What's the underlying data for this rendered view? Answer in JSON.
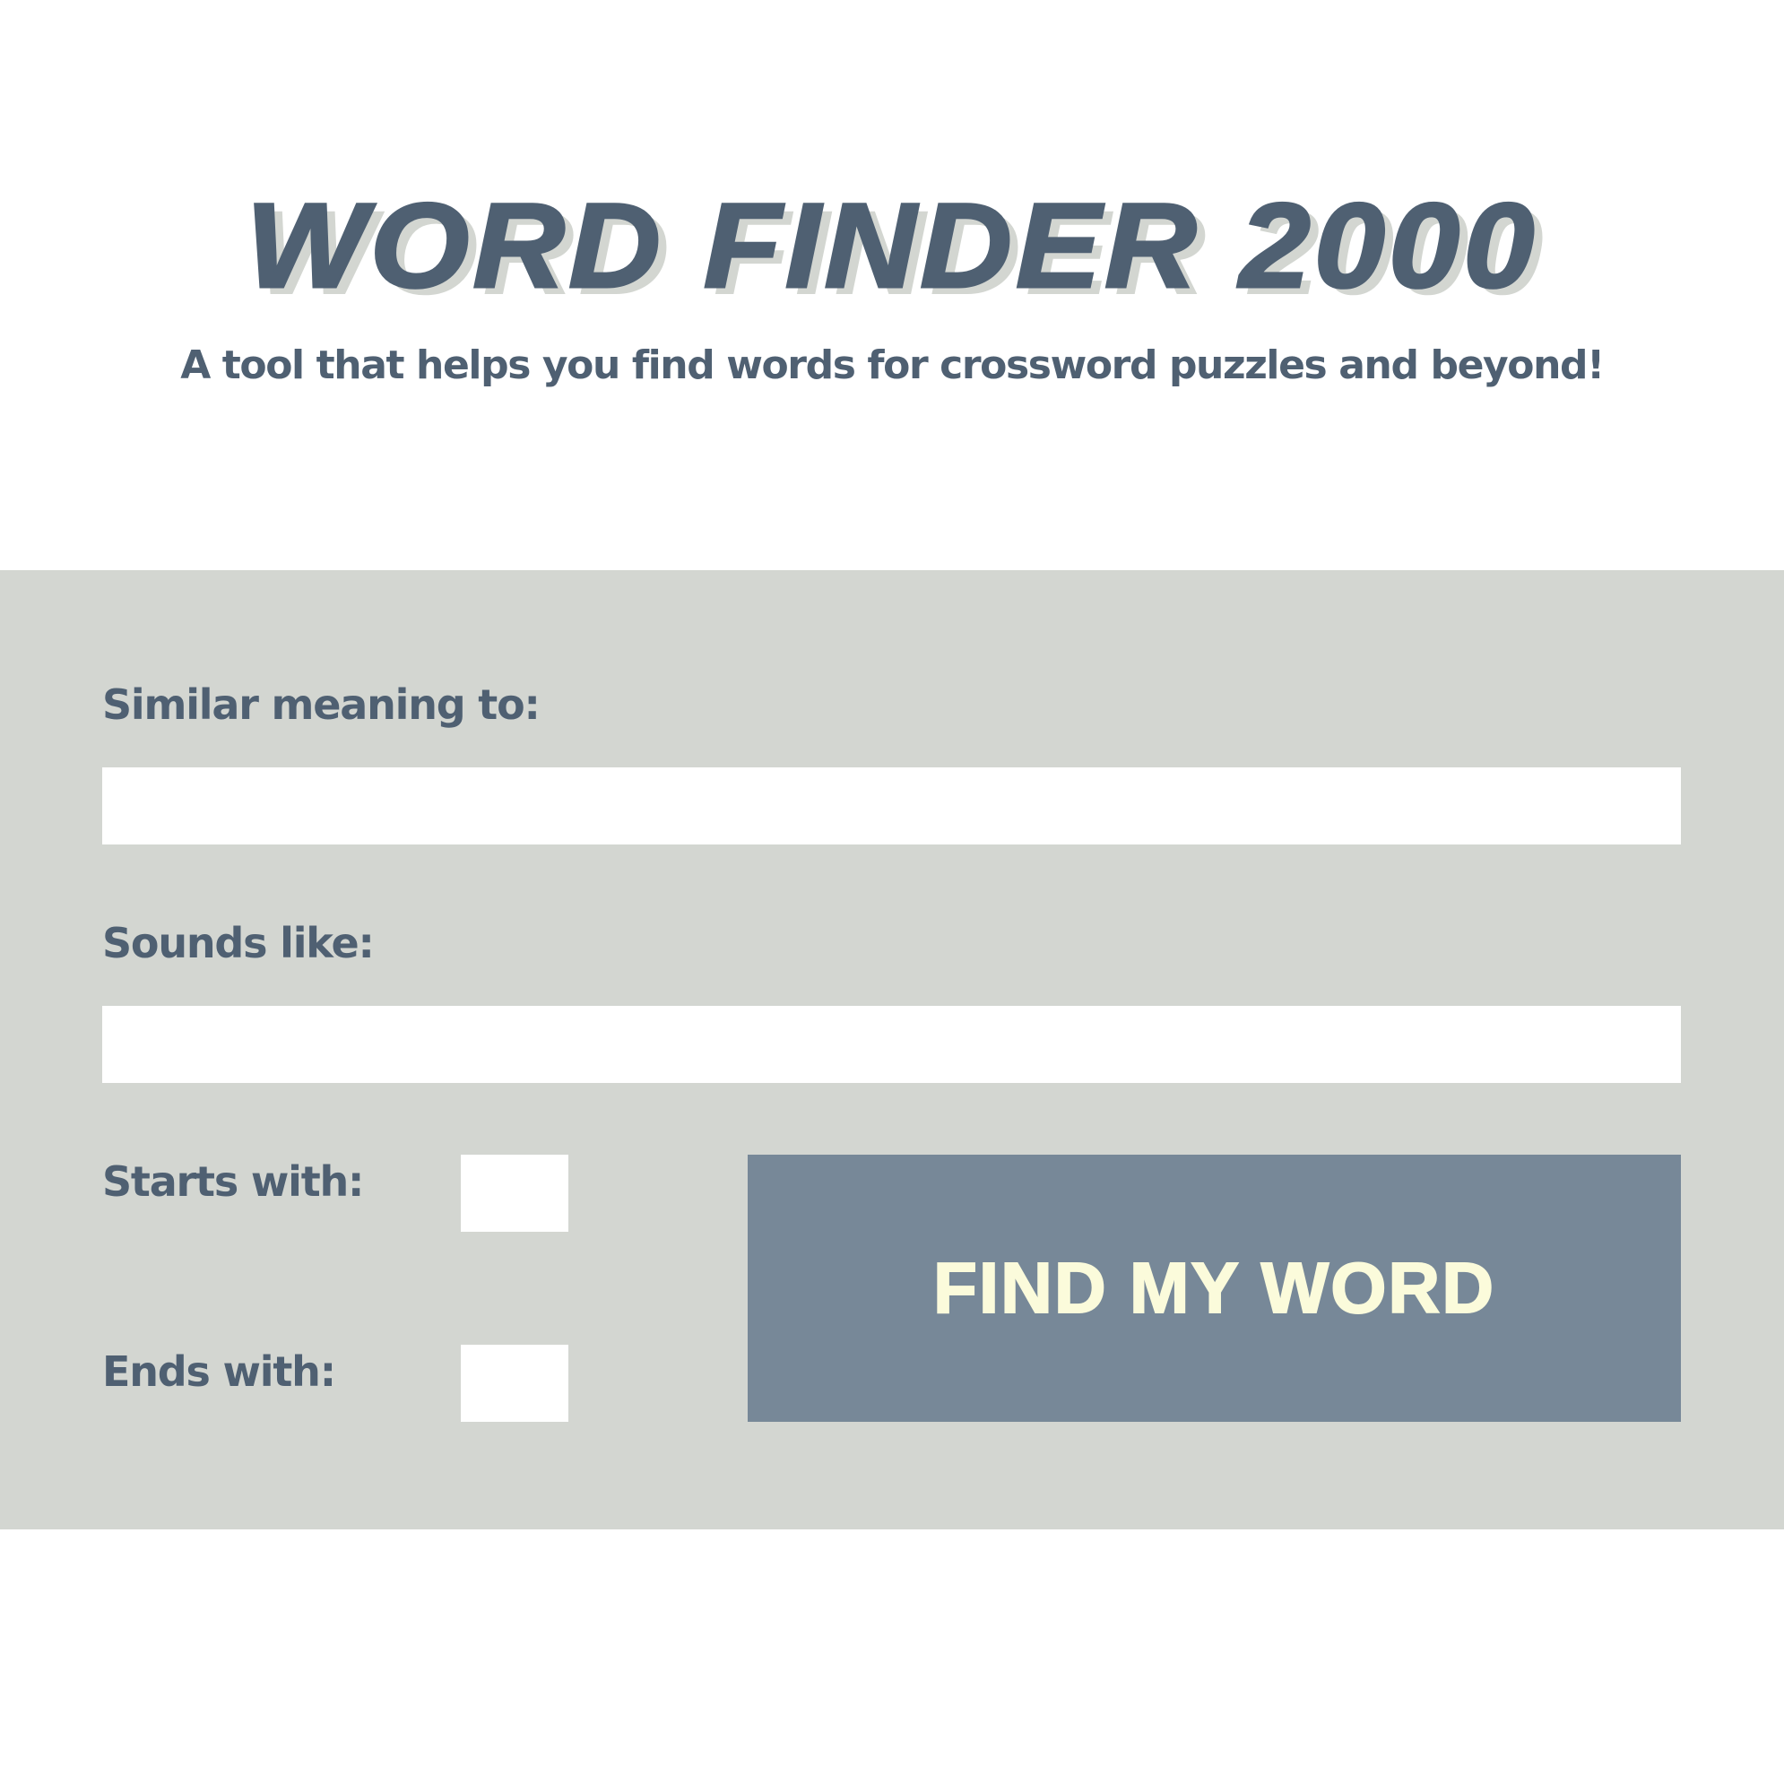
{
  "header": {
    "title": "WORD FINDER 2000",
    "subtitle": "A tool that helps you find words for crossword puzzles and beyond!"
  },
  "form": {
    "similar_meaning": {
      "label": "Similar meaning to:",
      "value": ""
    },
    "sounds_like": {
      "label": "Sounds like:",
      "value": ""
    },
    "starts_with": {
      "label": "Starts with:",
      "value": ""
    },
    "ends_with": {
      "label": "Ends with:",
      "value": ""
    },
    "submit_label": "FIND MY WORD"
  },
  "colors": {
    "text": "#4f6072",
    "panel_background": "#d3d6d1",
    "button_background": "#778898",
    "button_text": "#fbfbdb",
    "page_background": "#ffffff"
  }
}
